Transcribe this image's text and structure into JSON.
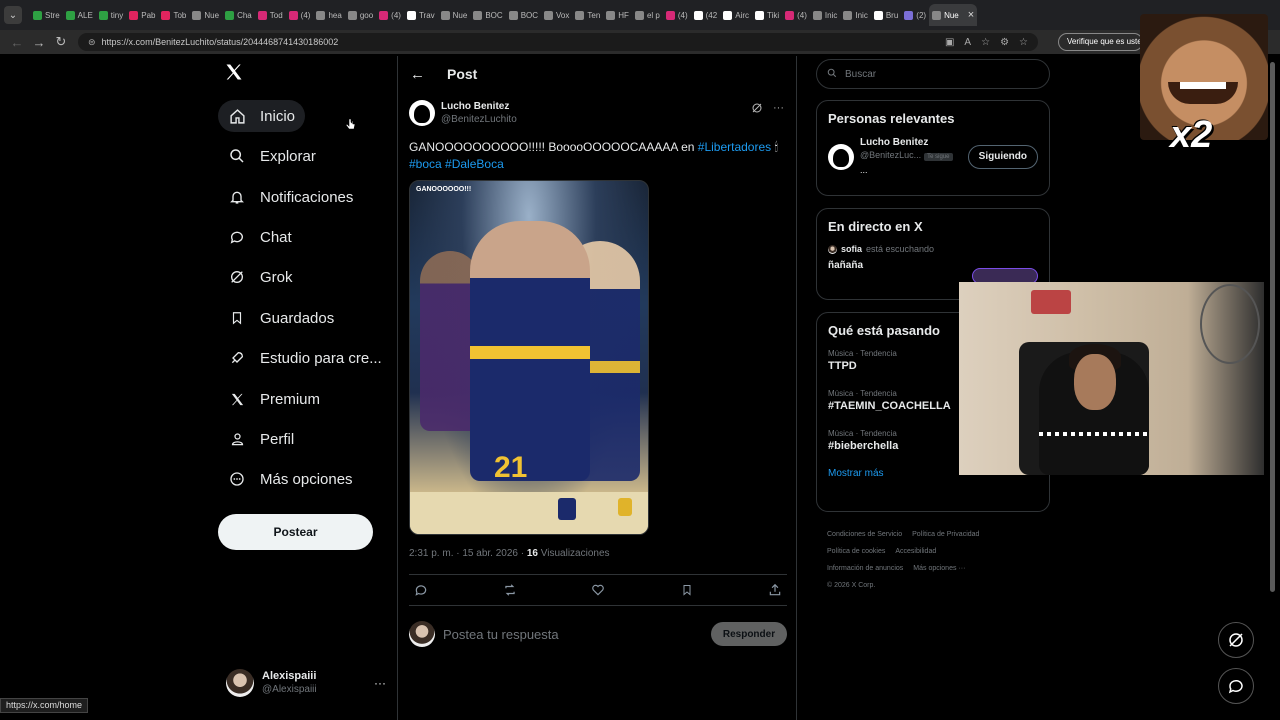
{
  "browser": {
    "tabs": [
      {
        "label": "Stre",
        "color": "#2ea043"
      },
      {
        "label": "ALE",
        "color": "#2ea043"
      },
      {
        "label": "tiny",
        "color": "#2ea043"
      },
      {
        "label": "Pab",
        "color": "#e0245e"
      },
      {
        "label": "Tob",
        "color": "#e0245e"
      },
      {
        "label": "Nue",
        "color": "#888888"
      },
      {
        "label": "Cha",
        "color": "#2ea043"
      },
      {
        "label": "Tod",
        "color": "#d62976"
      },
      {
        "label": "(4)",
        "color": "#d62976"
      },
      {
        "label": "hea",
        "color": "#888888"
      },
      {
        "label": "goo",
        "color": "#888888"
      },
      {
        "label": "(4)",
        "color": "#d62976"
      },
      {
        "label": "Trav",
        "color": "#ffffff"
      },
      {
        "label": "Nue",
        "color": "#888888"
      },
      {
        "label": "BOC",
        "color": "#888888"
      },
      {
        "label": "BOC",
        "color": "#888888"
      },
      {
        "label": "Vox",
        "color": "#888888"
      },
      {
        "label": "Ten",
        "color": "#888888"
      },
      {
        "label": "HF",
        "color": "#888888"
      },
      {
        "label": "el p",
        "color": "#888888"
      },
      {
        "label": "(4)",
        "color": "#d62976"
      },
      {
        "label": "(42",
        "color": "#ffffff"
      },
      {
        "label": "Airc",
        "color": "#ffffff"
      },
      {
        "label": "Tiki",
        "color": "#ffffff"
      },
      {
        "label": "(4)",
        "color": "#d62976"
      },
      {
        "label": "Inic",
        "color": "#888888"
      },
      {
        "label": "Inic",
        "color": "#888888"
      },
      {
        "label": "Bru",
        "color": "#ffffff"
      },
      {
        "label": "(2)",
        "color": "#7b6fd6"
      },
      {
        "label": "Nue",
        "color": "#888888"
      }
    ],
    "active_tab": "Nue",
    "url": "https://x.com/BenitezLuchito/status/2044468741430186002",
    "verify_label": "Verifique que es usted",
    "status_url": "https://x.com/home"
  },
  "nav": {
    "items": [
      {
        "label": "Inicio",
        "icon": "home-icon"
      },
      {
        "label": "Explorar",
        "icon": "search-icon"
      },
      {
        "label": "Notificaciones",
        "icon": "bell-icon"
      },
      {
        "label": "Chat",
        "icon": "chat-bubble-icon"
      },
      {
        "label": "Grok",
        "icon": "grok-icon"
      },
      {
        "label": "Guardados",
        "icon": "bookmark-icon"
      },
      {
        "label": "Estudio para cre...",
        "icon": "rocket-icon"
      },
      {
        "label": "Premium",
        "icon": "x-premium-icon"
      },
      {
        "label": "Perfil",
        "icon": "person-icon"
      },
      {
        "label": "Más opciones",
        "icon": "more-circle-icon"
      }
    ],
    "post_button": "Postear",
    "account": {
      "name": "Alexispaiii",
      "handle": "@Alexispaiii"
    }
  },
  "post": {
    "header_title": "Post",
    "author_name": "Lucho Benitez",
    "author_handle": "@BenitezLuchito",
    "text_main": "GANOOOOOOOOOO!!!!! BooooOOOOOCAAAAA  en ",
    "tag1": "#Libertadores",
    "tag2": "#boca",
    "tag3": "#DaleBoca",
    "image_caption": "GANOOOOOO!!!",
    "image_number": "21",
    "time": "2:31 p. m. · 15 abr. 2026 · ",
    "views_count": "16",
    "views_label": " Visualizaciones",
    "reply_placeholder": "Postea tu respuesta",
    "reply_button": "Responder"
  },
  "right": {
    "search_placeholder": "Buscar",
    "relevant_title": "Personas relevantes",
    "relevant_person": {
      "name": "Lucho Benitez",
      "handle": "@BenitezLuc...",
      "badge": "Te sigue",
      "button": "Siguiendo",
      "extra": "..."
    },
    "live_title": "En directo en X",
    "live_user": "sofia",
    "live_status": "está escuchando",
    "live_space": "ñañaña",
    "trending_title": "Qué está pasando",
    "trends": [
      {
        "category": "Música · Tendencia",
        "name": "TTPD"
      },
      {
        "category": "Música · Tendencia",
        "name": "#TAEMIN_COACHELLA"
      },
      {
        "category": "Música · Tendencia",
        "name": "#bieberchella"
      }
    ],
    "show_more": "Mostrar más",
    "footer": [
      "Condiciones de Servicio",
      "Política de Privacidad",
      "Política de cookies",
      "Accesibilidad",
      "Información de anuncios",
      "Más opciones ···",
      "© 2026 X Corp."
    ]
  },
  "overlay": {
    "meme_text": "x2"
  },
  "colors": {
    "accent": "#1d9bf0",
    "background": "#000000",
    "border": "#2f3336",
    "muted": "#71767b"
  }
}
